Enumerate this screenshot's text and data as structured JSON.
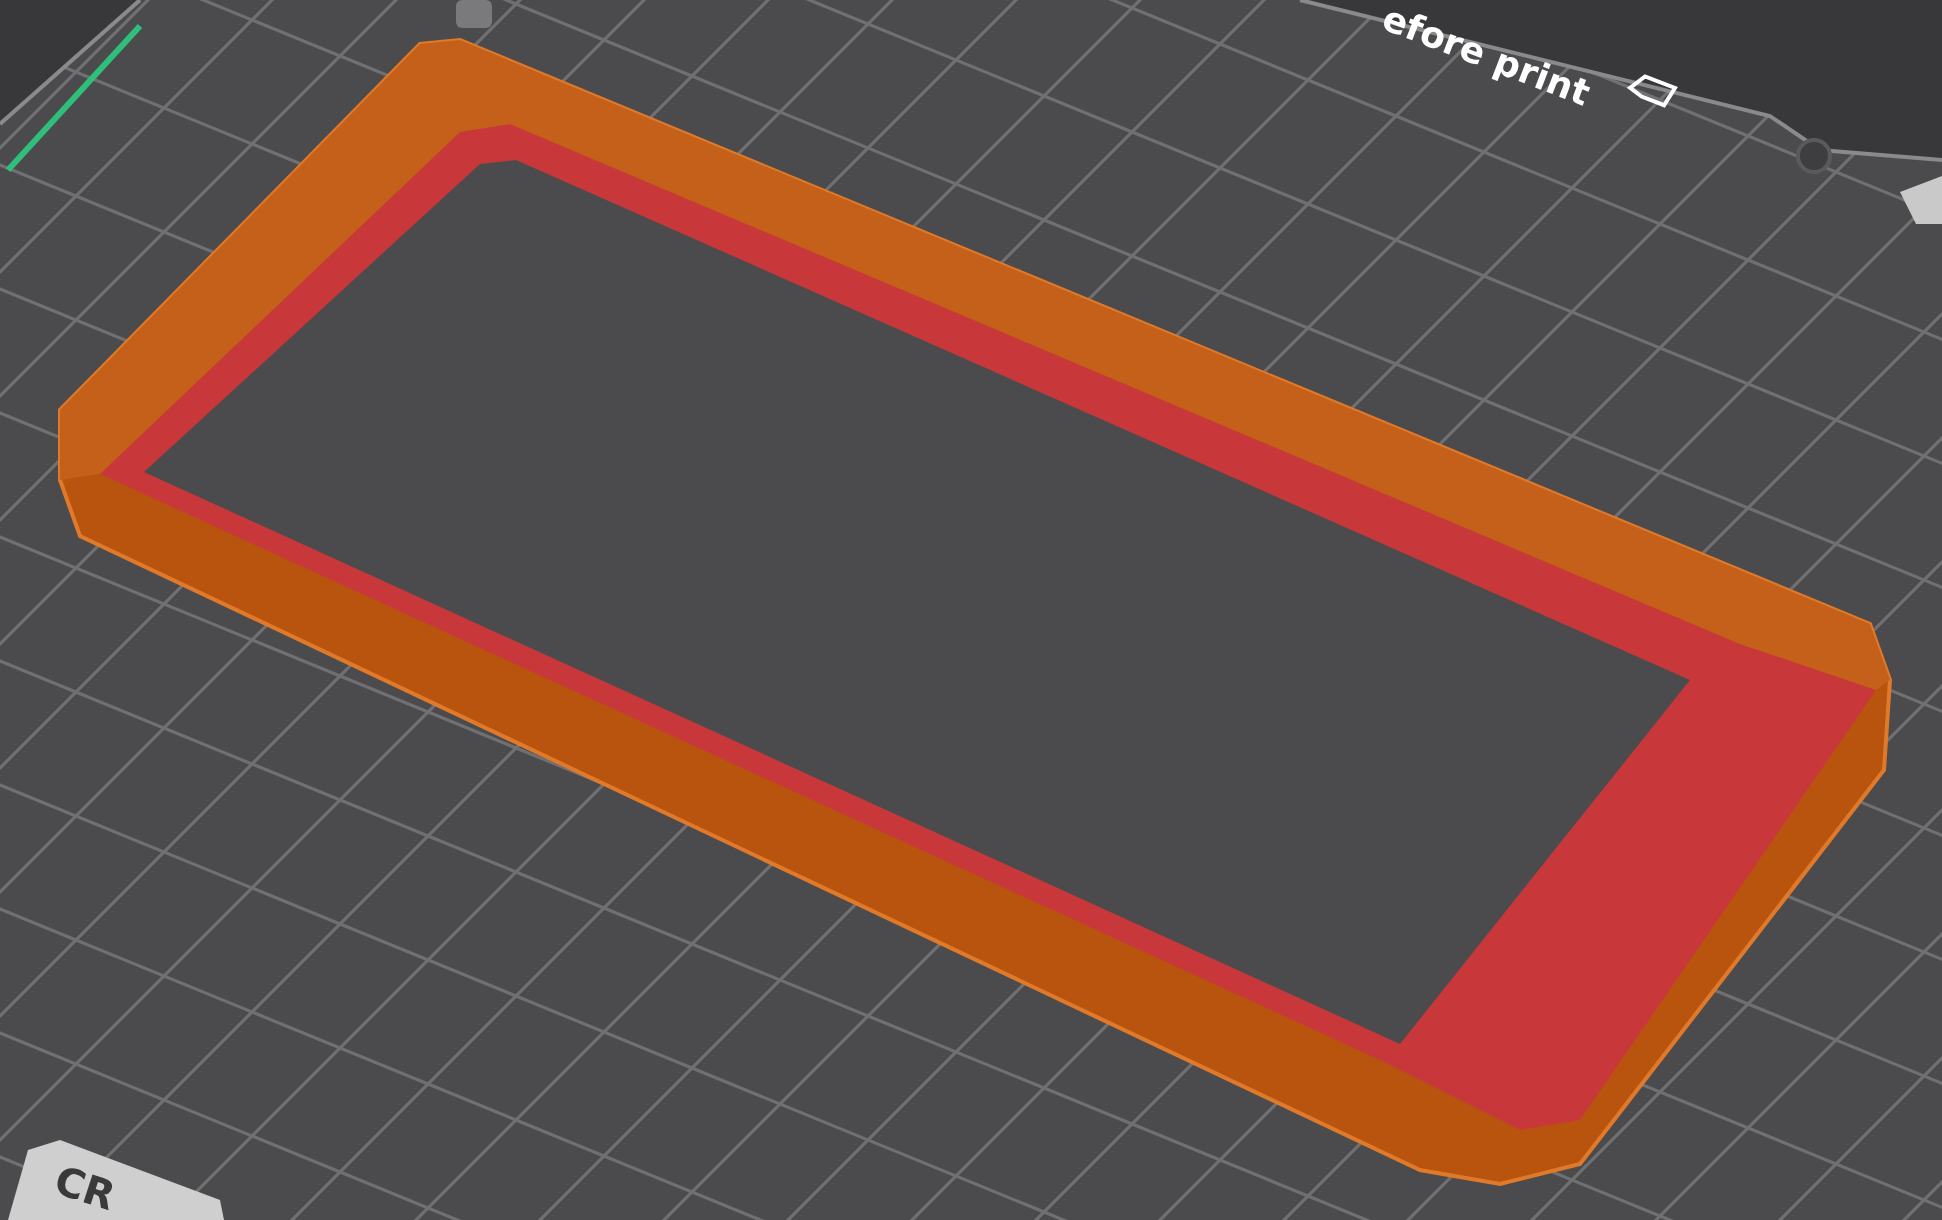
{
  "bed_label": "efore print",
  "bed_logo": "CR"
}
